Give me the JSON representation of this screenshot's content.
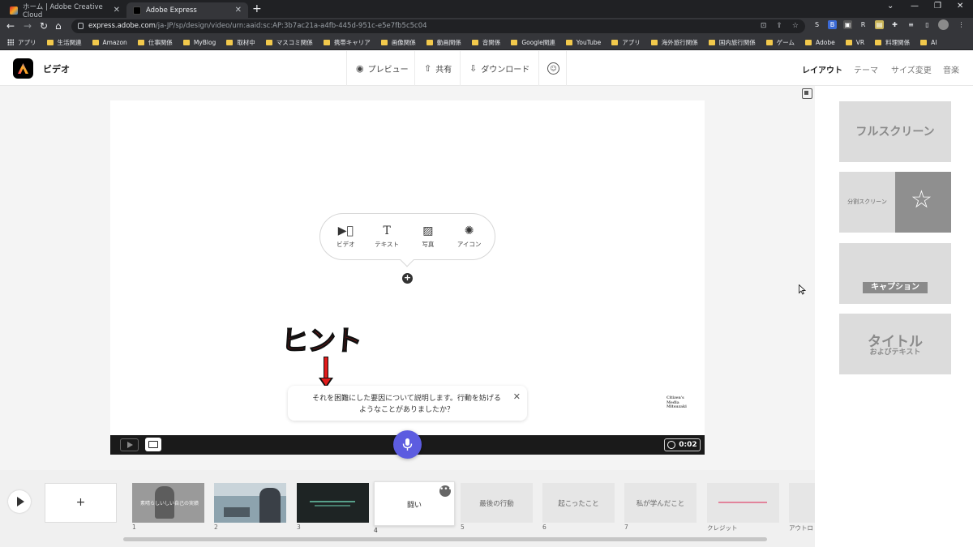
{
  "browser": {
    "tabs": [
      {
        "title": "ホーム | Adobe Creative Cloud",
        "active": false
      },
      {
        "title": "Adobe Express",
        "active": true
      }
    ],
    "new_tab": "+",
    "url_host": "express.adobe.com",
    "url_path": "/ja-JP/sp/design/video/urn:aaid:sc:AP:3b7ac21a-a4fb-445d-951c-e5e7fb5c5c04",
    "bookmarks": [
      "アプリ",
      "生活関連",
      "Amazon",
      "仕事関係",
      "MyBlog",
      "取材中",
      "マスコミ関係",
      "携帯キャリア",
      "画像関係",
      "動画関係",
      "音関係",
      "Google関連",
      "YouTube",
      "アプリ",
      "海外旅行関係",
      "国内旅行関係",
      "ゲーム",
      "Adobe",
      "VR",
      "料理関係",
      "AI"
    ]
  },
  "app": {
    "title": "ビデオ",
    "preview": "プレビュー",
    "share": "共有",
    "download": "ダウンロード",
    "tabs": [
      "レイアウト",
      "テーマ",
      "サイズ変更",
      "音楽"
    ]
  },
  "canvas": {
    "add_options": [
      {
        "icon": "video-icon",
        "label": "ビデオ"
      },
      {
        "icon": "text-icon",
        "label": "テキスト"
      },
      {
        "icon": "photo-icon",
        "label": "写真"
      },
      {
        "icon": "icon-icon",
        "label": "アイコン"
      }
    ],
    "hint_label": "ヒント",
    "prompt_text": "それを困難にした要因について説明します。行動を妨げるようなことがありましたか？",
    "watermark": "Citizen's Media Mitsuzaki",
    "duration": "0:02"
  },
  "layouts": {
    "fullscreen": "フルスクリーン",
    "split": "分割スクリーン",
    "caption": "キャプション",
    "title_line1": "タイトル",
    "title_line2": "およびテキスト"
  },
  "timeline": {
    "add": "+",
    "scenes": [
      {
        "num": "1",
        "label": ""
      },
      {
        "num": "2",
        "label": ""
      },
      {
        "num": "3",
        "label": ""
      },
      {
        "num": "4",
        "label": "闘い"
      },
      {
        "num": "5",
        "label": "最後の行動"
      },
      {
        "num": "6",
        "label": "起こったこと"
      },
      {
        "num": "7",
        "label": "私が学んだこと"
      },
      {
        "num": "クレジット",
        "label": ""
      },
      {
        "num": "アウトロ",
        "label": ""
      }
    ],
    "scene1_caption": "素晴らしいしい自己の実績"
  }
}
